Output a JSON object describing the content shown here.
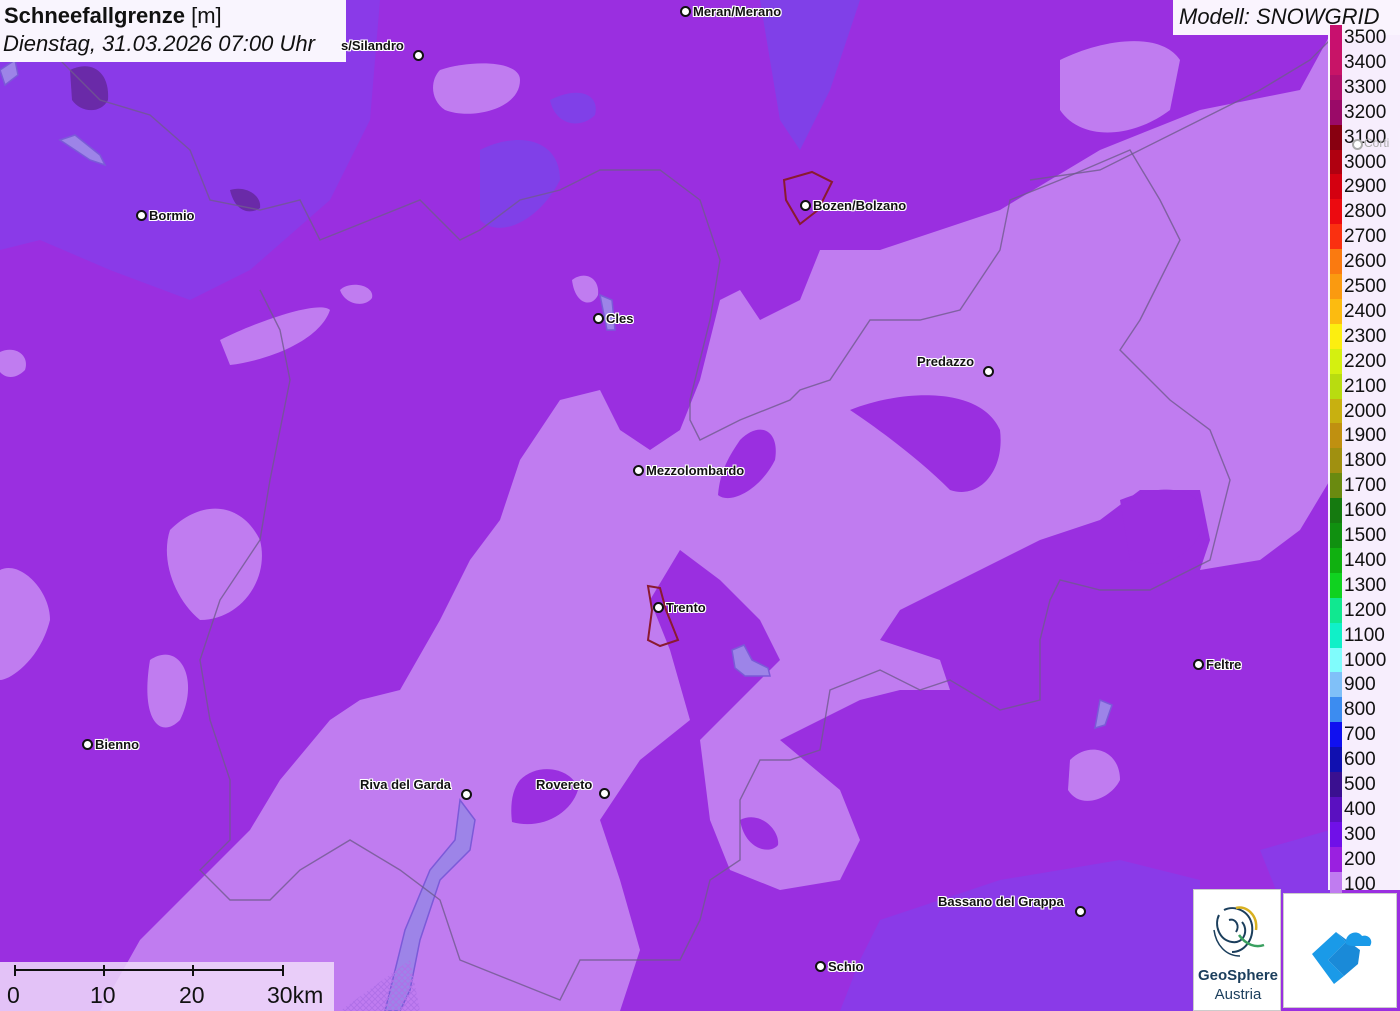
{
  "title": {
    "main": "Schneefallgrenze",
    "unit": "[m]",
    "datetime": "Dienstag, 31.03.2026 07:00 Uhr"
  },
  "model": {
    "label": "Modell: SNOWGRID"
  },
  "legend": [
    {
      "value": "3500",
      "color": "#c8106e"
    },
    {
      "value": "3400",
      "color": "#c81467"
    },
    {
      "value": "3300",
      "color": "#b0106a"
    },
    {
      "value": "3200",
      "color": "#9a0a68"
    },
    {
      "value": "3100",
      "color": "#880010"
    },
    {
      "value": "3000",
      "color": "#b00010"
    },
    {
      "value": "2900",
      "color": "#d40010"
    },
    {
      "value": "2800",
      "color": "#ec0a10"
    },
    {
      "value": "2700",
      "color": "#fa3010"
    },
    {
      "value": "2600",
      "color": "#fa7a10"
    },
    {
      "value": "2500",
      "color": "#fa9a10"
    },
    {
      "value": "2400",
      "color": "#fcbb10"
    },
    {
      "value": "2300",
      "color": "#fcee10"
    },
    {
      "value": "2200",
      "color": "#d4f010"
    },
    {
      "value": "2100",
      "color": "#b8dc10"
    },
    {
      "value": "2000",
      "color": "#c8b010"
    },
    {
      "value": "1900",
      "color": "#c09010"
    },
    {
      "value": "1800",
      "color": "#a09010"
    },
    {
      "value": "1700",
      "color": "#6a8a10"
    },
    {
      "value": "1600",
      "color": "#157a10"
    },
    {
      "value": "1500",
      "color": "#109010"
    },
    {
      "value": "1400",
      "color": "#10b010"
    },
    {
      "value": "1300",
      "color": "#10d220"
    },
    {
      "value": "1200",
      "color": "#10e890"
    },
    {
      "value": "1100",
      "color": "#10f0c8"
    },
    {
      "value": "1000",
      "color": "#80fcfc"
    },
    {
      "value": "900",
      "color": "#80c0f8"
    },
    {
      "value": "800",
      "color": "#3c8cf0"
    },
    {
      "value": "700",
      "color": "#1010f0"
    },
    {
      "value": "600",
      "color": "#1010b0"
    },
    {
      "value": "500",
      "color": "#3a1090"
    },
    {
      "value": "400",
      "color": "#5a10c0"
    },
    {
      "value": "300",
      "color": "#7010e8"
    },
    {
      "value": "200",
      "color": "#9a20e0"
    },
    {
      "value": "100",
      "color": "#c07cf0"
    }
  ],
  "cities": [
    {
      "name": "Meran/Merano"
    },
    {
      "name": "s/Silandro"
    },
    {
      "name": "Bormio"
    },
    {
      "name": "Bozen/Bolzano"
    },
    {
      "name": "Cles"
    },
    {
      "name": "Predazzo"
    },
    {
      "name": "Mezzolombardo"
    },
    {
      "name": "Trento"
    },
    {
      "name": "Feltre"
    },
    {
      "name": "Bienno"
    },
    {
      "name": "Riva del Garda"
    },
    {
      "name": "Rovereto"
    },
    {
      "name": "Bassano del Grappa"
    },
    {
      "name": "Schio"
    },
    {
      "name": "Corti"
    }
  ],
  "scale": {
    "labels": [
      "0",
      "10",
      "20",
      "30km"
    ]
  },
  "logos": {
    "geosphere_line1": "GeoSphere",
    "geosphere_line2": "Austria"
  }
}
